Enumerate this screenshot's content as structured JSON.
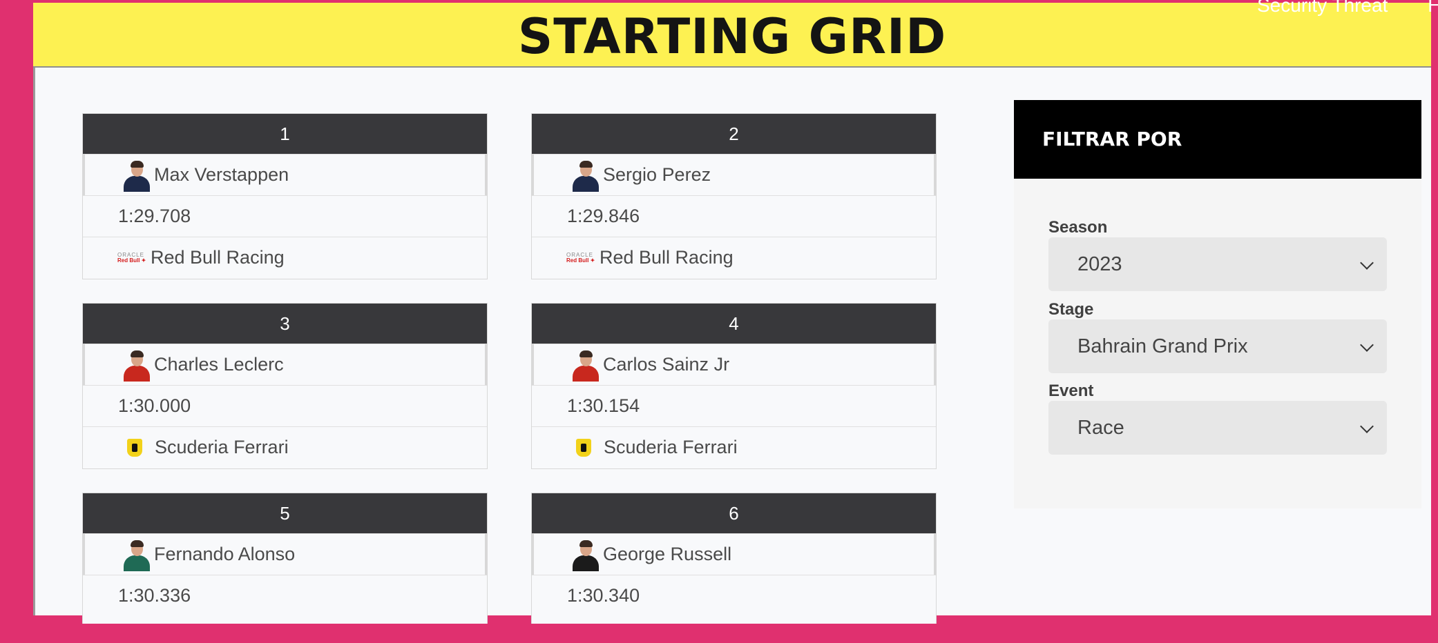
{
  "topnav": {
    "items": [
      "Security Threat",
      "Ho"
    ]
  },
  "header": {
    "title": "STARTING GRID"
  },
  "grid": [
    {
      "position": "1",
      "driver": "Max Verstappen",
      "time": "1:29.708",
      "team": "Red Bull Racing",
      "team_logo": "red-bull-racing-logo"
    },
    {
      "position": "2",
      "driver": "Sergio Perez",
      "time": "1:29.846",
      "team": "Red Bull Racing",
      "team_logo": "red-bull-racing-logo"
    },
    {
      "position": "3",
      "driver": "Charles Leclerc",
      "time": "1:30.000",
      "team": "Scuderia Ferrari",
      "team_logo": "ferrari-logo"
    },
    {
      "position": "4",
      "driver": "Carlos Sainz Jr",
      "time": "1:30.154",
      "team": "Scuderia Ferrari",
      "team_logo": "ferrari-logo"
    },
    {
      "position": "5",
      "driver": "Fernando Alonso",
      "time": "1:30.336",
      "team": "",
      "team_logo": ""
    },
    {
      "position": "6",
      "driver": "George Russell",
      "time": "1:30.340",
      "team": "",
      "team_logo": ""
    }
  ],
  "filter": {
    "title": "FILTRAR POR",
    "season": {
      "label": "Season",
      "value": "2023"
    },
    "stage": {
      "label": "Stage",
      "value": "Bahrain Grand Prix"
    },
    "event": {
      "label": "Event",
      "value": "Race"
    }
  },
  "colors": {
    "page_bg": "#e0306f",
    "header_bg": "#fdf152",
    "card_header_bg": "#38383b",
    "filter_header_bg": "#000000",
    "red_bull_suit": "#1e2a4a",
    "ferrari_suit": "#c8281e",
    "aston_suit": "#1f6a55",
    "mercedes_suit": "#1b1b1b"
  }
}
